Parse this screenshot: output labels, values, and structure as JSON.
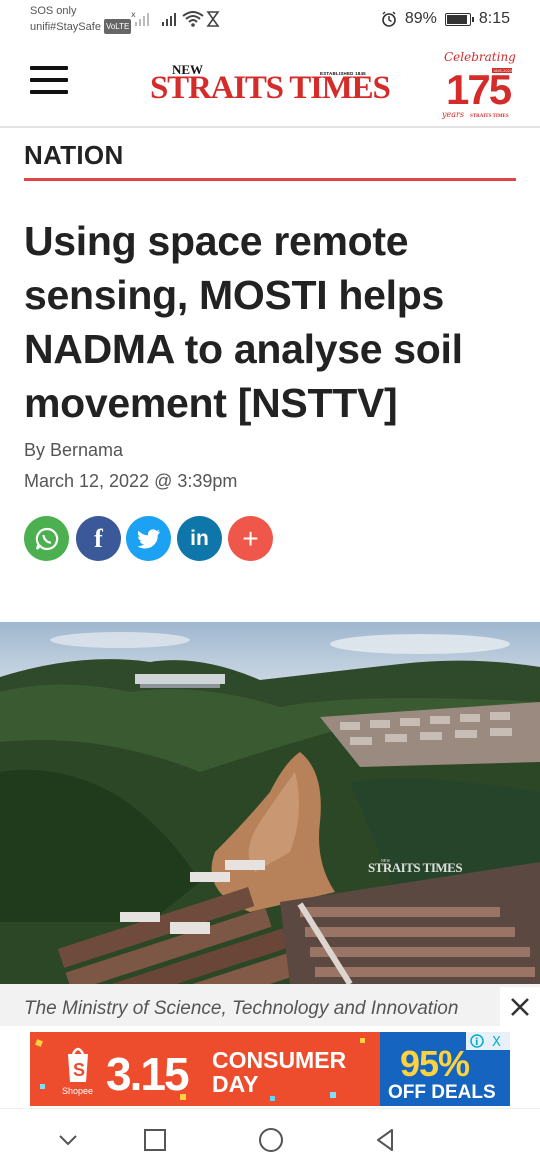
{
  "status_bar": {
    "carrier_line1": "SOS only",
    "carrier_line2": "unifi#StaySafe",
    "volte": "VoLTE",
    "battery": "89%",
    "time": "8:15"
  },
  "header": {
    "logo_new": "NEW",
    "logo_established": "ESTABLISHED 1845",
    "logo_main": "STRAITS TIMES",
    "badge_celebrating": "Celebrating",
    "badge_number": "175",
    "badge_years": "years",
    "badge_range": "1845-2020"
  },
  "article": {
    "section": "NATION",
    "headline": "Using space remote sensing, MOSTI helps NADMA to analyse soil movement [NSTTV]",
    "byline": "By Bernama",
    "date": "March 12, 2022 @ 3:39pm",
    "photo_watermark": "STRAITS TIMES",
    "photo_watermark_new": "NEW",
    "caption": "The Ministry of Science, Technology and Innovation"
  },
  "share_buttons": [
    {
      "id": "whatsapp",
      "color": "#4caf50"
    },
    {
      "id": "facebook",
      "color": "#3b5998",
      "label": "f"
    },
    {
      "id": "twitter",
      "color": "#1da1f2"
    },
    {
      "id": "linkedin",
      "color": "#0e76a8",
      "label": "in"
    },
    {
      "id": "more",
      "color": "#f0574b",
      "label": "+"
    }
  ],
  "ad": {
    "brand": "Shopee",
    "promo_number": "3.15",
    "promo_line1": "CONSUMER",
    "promo_line2": "DAY",
    "discount": "95%",
    "discount_label": "OFF DEALS",
    "adchoices": "i",
    "close": "X"
  },
  "colors": {
    "accent_red": "#e04545",
    "brand_red": "#d42b2b",
    "shopee_orange": "#ee4d2d",
    "deal_blue": "#1565c0"
  }
}
